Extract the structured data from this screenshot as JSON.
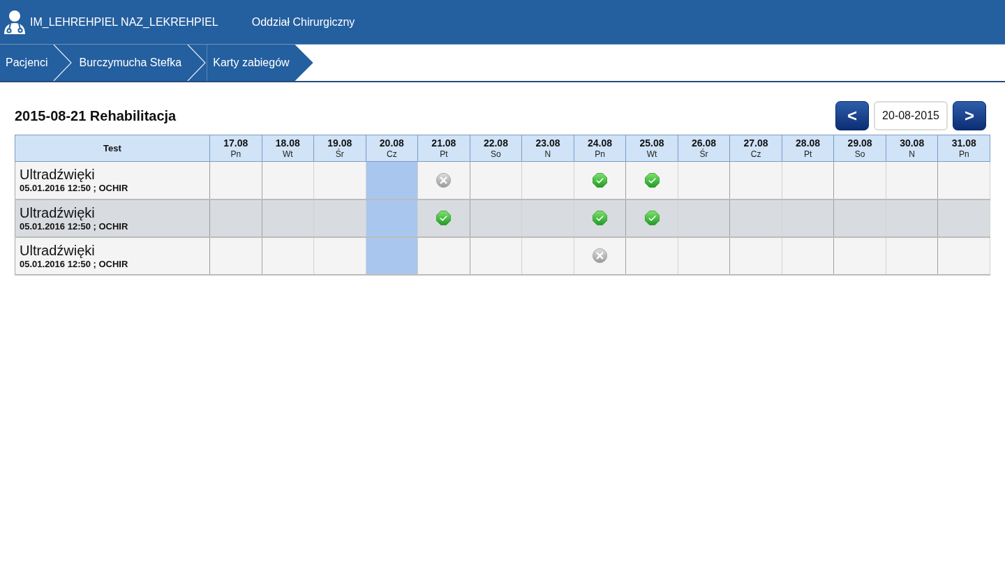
{
  "header": {
    "user": "IM_LEHREHPIEL NAZ_LEKREHPIEL",
    "department": "Oddział Chirurgiczny"
  },
  "breadcrumbs": [
    {
      "label": "Pacjenci"
    },
    {
      "label": "Burczymucha Stefka"
    },
    {
      "label": "Karty zabiegów"
    }
  ],
  "page": {
    "title": "2015-08-21 Rehabilitacja"
  },
  "date_nav": {
    "prev": "<",
    "date": "20-08-2015",
    "next": ">"
  },
  "table": {
    "first_column": "Test",
    "days": [
      {
        "date": "17.08",
        "weekday": "Pn",
        "selected": false
      },
      {
        "date": "18.08",
        "weekday": "Wt",
        "selected": false
      },
      {
        "date": "19.08",
        "weekday": "Śr",
        "selected": false
      },
      {
        "date": "20.08",
        "weekday": "Cz",
        "selected": true
      },
      {
        "date": "21.08",
        "weekday": "Pt",
        "selected": false
      },
      {
        "date": "22.08",
        "weekday": "So",
        "selected": false
      },
      {
        "date": "23.08",
        "weekday": "N",
        "selected": false
      },
      {
        "date": "24.08",
        "weekday": "Pn",
        "selected": false
      },
      {
        "date": "25.08",
        "weekday": "Wt",
        "selected": false
      },
      {
        "date": "26.08",
        "weekday": "Śr",
        "selected": false
      },
      {
        "date": "27.08",
        "weekday": "Cz",
        "selected": false
      },
      {
        "date": "28.08",
        "weekday": "Pt",
        "selected": false
      },
      {
        "date": "29.08",
        "weekday": "So",
        "selected": false
      },
      {
        "date": "30.08",
        "weekday": "N",
        "selected": false
      },
      {
        "date": "31.08",
        "weekday": "Pn",
        "selected": false
      }
    ],
    "rows": [
      {
        "name": "Ultradźwięki",
        "meta": "05.01.2016 12:50 ; OCHIR",
        "selected": false,
        "cells": [
          {
            "kind": "empty"
          },
          {
            "kind": "empty"
          },
          {
            "kind": "empty"
          },
          {
            "kind": "empty"
          },
          {
            "kind": "cancelled"
          },
          {
            "kind": "empty"
          },
          {
            "kind": "empty"
          },
          {
            "kind": "done"
          },
          {
            "kind": "done"
          },
          {
            "kind": "empty"
          },
          {
            "kind": "empty"
          },
          {
            "kind": "empty"
          },
          {
            "kind": "empty"
          },
          {
            "kind": "empty"
          },
          {
            "kind": "empty"
          }
        ]
      },
      {
        "name": "Ultradźwięki",
        "meta": "05.01.2016 12:50 ; OCHIR",
        "selected": true,
        "cells": [
          {
            "kind": "empty"
          },
          {
            "kind": "empty"
          },
          {
            "kind": "empty"
          },
          {
            "kind": "empty"
          },
          {
            "kind": "done"
          },
          {
            "kind": "empty"
          },
          {
            "kind": "empty"
          },
          {
            "kind": "done"
          },
          {
            "kind": "done"
          },
          {
            "kind": "empty"
          },
          {
            "kind": "empty"
          },
          {
            "kind": "empty"
          },
          {
            "kind": "empty"
          },
          {
            "kind": "empty"
          },
          {
            "kind": "empty"
          }
        ]
      },
      {
        "name": "Ultradźwięki",
        "meta": "05.01.2016 12:50 ; OCHIR",
        "selected": false,
        "cells": [
          {
            "kind": "empty"
          },
          {
            "kind": "empty"
          },
          {
            "kind": "empty"
          },
          {
            "kind": "empty"
          },
          {
            "kind": "empty"
          },
          {
            "kind": "empty"
          },
          {
            "kind": "empty"
          },
          {
            "kind": "cancelled"
          },
          {
            "kind": "empty"
          },
          {
            "kind": "empty"
          },
          {
            "kind": "empty"
          },
          {
            "kind": "empty"
          },
          {
            "kind": "empty"
          },
          {
            "kind": "empty"
          },
          {
            "kind": "empty"
          }
        ]
      }
    ]
  }
}
